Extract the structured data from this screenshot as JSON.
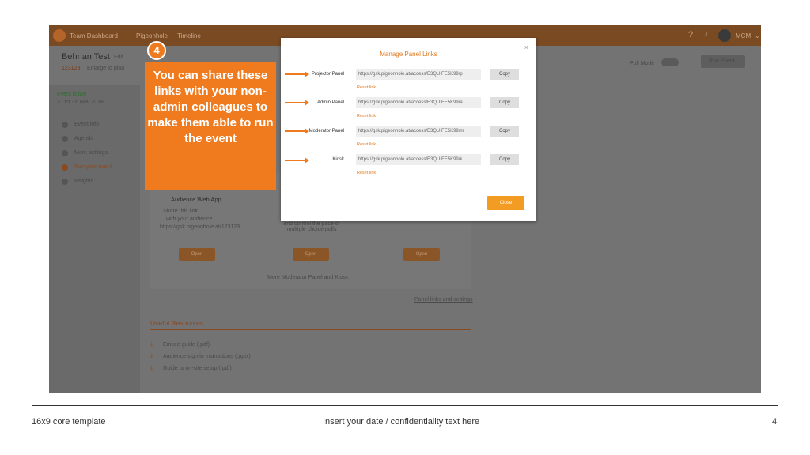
{
  "app": {
    "nav": [
      "Team Dashboard",
      "Pigeonhole",
      "Timeline"
    ],
    "user_initials": "MCM",
    "event_title": "Behnan Test",
    "edit_label": "Edit",
    "event_code": "123123",
    "plan_label": "Enlarge to plan",
    "status": "Event is live",
    "date": "3 Oct - 6 Nov 2018",
    "sidebar_items": [
      "Event info",
      "Agenda",
      "More settings",
      "Run your event",
      "Insights"
    ],
    "card_title": "Audience Web App",
    "card_text_1": "Share this link",
    "card_text_2": "with your audience",
    "card_url": "https://gsk.pigeonhole.at/123123",
    "card_mid_text": "and control the pace of multiple choice polls",
    "open_label": "Open",
    "more_label": "More Moderator Panel and Kiosk",
    "panel_link_label": "Panel links and settings",
    "resources_title": "Useful Resources",
    "resources": [
      "Emcee guide (.pdf)",
      "Audience sign-in instructions (.pptx)",
      "Guide to on-site setup (.pdf)"
    ],
    "poll_mode": "Poll Mode",
    "run_button": "Run Event"
  },
  "modal": {
    "title": "Manage Panel Links",
    "close_icon": "×",
    "rows": [
      {
        "label": "Projector Panel",
        "url": "https://gsk.pigeonhole.at/access/E3QUIFE5K99/p",
        "copy": "Copy",
        "reset": "Reset link"
      },
      {
        "label": "Admin Panel",
        "url": "https://gsk.pigeonhole.at/access/E3QUIFE5K99/a",
        "copy": "Copy",
        "reset": "Reset link"
      },
      {
        "label": "Moderator Panel",
        "url": "https://gsk.pigeonhole.at/access/E3QUIFE5K99/m",
        "copy": "Copy",
        "reset": "Reset link"
      },
      {
        "label": "Kiosk",
        "url": "https://gsk.pigeonhole.at/access/E3QUIFE5K99/k",
        "copy": "Copy",
        "reset": "Reset link"
      }
    ],
    "close_button": "Close"
  },
  "callout": {
    "badge": "4",
    "text": "You can share these links with your non-admin colleagues to make them able to run the event"
  },
  "footer": {
    "left": "16x9 core template",
    "center": "Insert your date / confidentiality text here",
    "page": "4"
  },
  "colors": {
    "accent": "#f07a1e",
    "modal_title": "#e07b1f"
  }
}
